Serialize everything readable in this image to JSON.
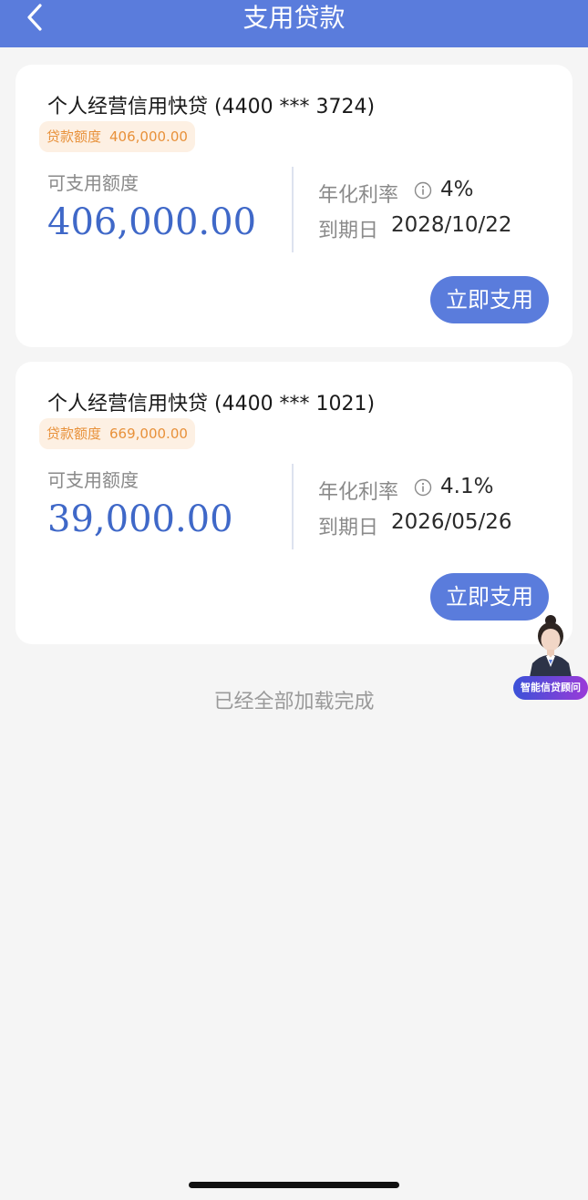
{
  "header": {
    "title": "支用贷款"
  },
  "loans": [
    {
      "title": "个人经营信用快贷 (4400 *** 3724)",
      "limit_label": "贷款额度",
      "limit_value": "406,000.00",
      "available_label": "可支用额度",
      "available_amount": "406,000.00",
      "rate_label": "年化利率",
      "rate_value": "4%",
      "due_label": "到期日",
      "due_value": "2028/10/22",
      "button_label": "立即支用"
    },
    {
      "title": "个人经营信用快贷 (4400 *** 1021)",
      "limit_label": "贷款额度",
      "limit_value": "669,000.00",
      "available_label": "可支用额度",
      "available_amount": "39,000.00",
      "rate_label": "年化利率",
      "rate_value": "4.1%",
      "due_label": "到期日",
      "due_value": "2026/05/26",
      "button_label": "立即支用"
    }
  ],
  "footer_text": "已经全部加载完成",
  "advisor": {
    "label": "智能信贷顾问"
  },
  "icons": {
    "back": "chevron-left-icon",
    "info": "info-circle-icon",
    "advisor": "advisor-avatar-icon"
  },
  "colors": {
    "primary": "#5a7cdc",
    "amount": "#3f68c8",
    "badge_text": "#e8913a",
    "badge_bg": "#fdf0e3",
    "background": "#f5f5f5"
  }
}
